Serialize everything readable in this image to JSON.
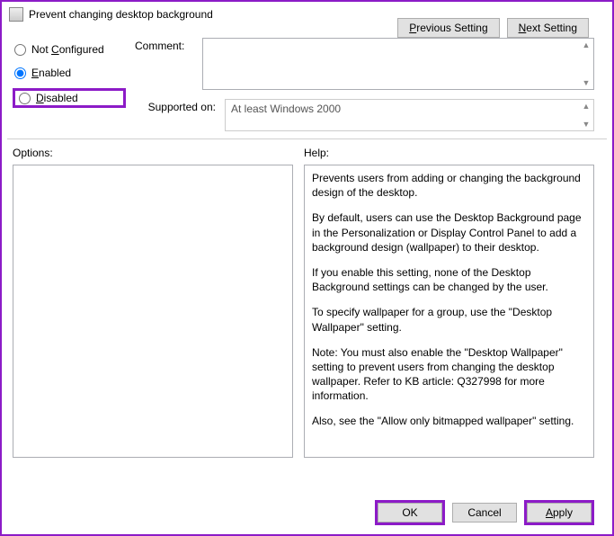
{
  "title": "Prevent changing desktop background",
  "buttons": {
    "previous": "Previous Setting",
    "next": "Next Setting",
    "ok": "OK",
    "cancel": "Cancel",
    "apply": "Apply"
  },
  "radio": {
    "not_configured": "Not Configured",
    "enabled": "Enabled",
    "disabled": "Disabled",
    "selected": "enabled"
  },
  "labels": {
    "comment": "Comment:",
    "supported_on": "Supported on:",
    "options": "Options:",
    "help": "Help:"
  },
  "comment_value": "",
  "supported_on_value": "At least Windows 2000",
  "help_text": {
    "p1": "Prevents users from adding or changing the background design of the desktop.",
    "p2": "By default, users can use the Desktop Background page in the Personalization or Display Control Panel to add a background design (wallpaper) to their desktop.",
    "p3": "If you enable this setting, none of the Desktop Background settings can be changed by the user.",
    "p4": "To specify wallpaper for a group, use the \"Desktop Wallpaper\" setting.",
    "p5": "Note: You must also enable the \"Desktop Wallpaper\" setting to prevent users from changing the desktop wallpaper. Refer to KB article: Q327998 for more information.",
    "p6": "Also, see the \"Allow only bitmapped wallpaper\" setting."
  },
  "mnemonics": {
    "previous": "P",
    "next": "N",
    "not_configured": "C",
    "enabled": "E",
    "disabled": "D",
    "apply": "A"
  }
}
